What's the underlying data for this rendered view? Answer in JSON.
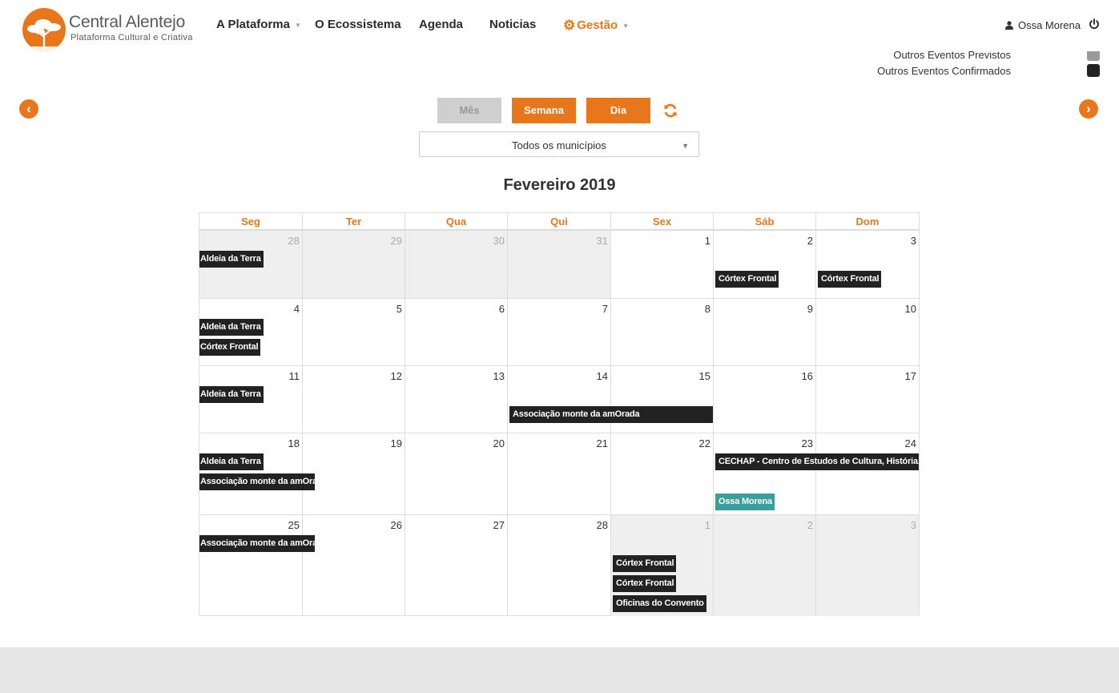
{
  "brand": {
    "title": "Central Alentejo",
    "subtitle": "Plataforma Cultural e Criativa",
    "accent": "#e8771c"
  },
  "nav": {
    "items": [
      {
        "label": "A Plataforma",
        "has_dropdown": true
      },
      {
        "label": "O Ecossistema",
        "has_dropdown": false
      },
      {
        "label": "Agenda",
        "has_dropdown": false
      },
      {
        "label": "Noticias",
        "has_dropdown": false
      },
      {
        "label": "Gestão",
        "has_dropdown": true,
        "icon": "gears-icon"
      }
    ]
  },
  "user": {
    "name": "Ossa Morena",
    "icon": "user-icon",
    "logout_icon": "power-icon"
  },
  "legend": {
    "items": [
      {
        "label": "Outros Eventos Previstos",
        "color": "#9a9a9a"
      },
      {
        "label": "Outros Eventos Confirmados",
        "color": "#222222"
      }
    ]
  },
  "toolbar": {
    "views": [
      {
        "label": "Mês",
        "active": false
      },
      {
        "label": "Semana",
        "active": true
      },
      {
        "label": "Dia",
        "active": true
      }
    ],
    "refresh_icon": "refresh-icon",
    "prev_icon": "chevron-left-icon",
    "next_icon": "chevron-right-icon",
    "municipality_select": "Todos os municípios"
  },
  "calendar": {
    "title": "Fevereiro 2019",
    "weekdays": [
      "Seg",
      "Ter",
      "Qua",
      "Qui",
      "Sex",
      "Sáb",
      "Dom"
    ],
    "weeks": [
      [
        {
          "day": "28",
          "other": true
        },
        {
          "day": "29",
          "other": true
        },
        {
          "day": "30",
          "other": true
        },
        {
          "day": "31",
          "other": true
        },
        {
          "day": "1",
          "other": false
        },
        {
          "day": "2",
          "other": false
        },
        {
          "day": "3",
          "other": false
        }
      ],
      [
        {
          "day": "4",
          "other": false
        },
        {
          "day": "5",
          "other": false
        },
        {
          "day": "6",
          "other": false
        },
        {
          "day": "7",
          "other": false
        },
        {
          "day": "8",
          "other": false
        },
        {
          "day": "9",
          "other": false
        },
        {
          "day": "10",
          "other": false
        }
      ],
      [
        {
          "day": "11",
          "other": false
        },
        {
          "day": "12",
          "other": false
        },
        {
          "day": "13",
          "other": false
        },
        {
          "day": "14",
          "other": false
        },
        {
          "day": "15",
          "other": false
        },
        {
          "day": "16",
          "other": false
        },
        {
          "day": "17",
          "other": false
        }
      ],
      [
        {
          "day": "18",
          "other": false
        },
        {
          "day": "19",
          "other": false
        },
        {
          "day": "20",
          "other": false
        },
        {
          "day": "21",
          "other": false
        },
        {
          "day": "22",
          "other": false
        },
        {
          "day": "23",
          "other": false
        },
        {
          "day": "24",
          "other": false
        }
      ],
      [
        {
          "day": "25",
          "other": false
        },
        {
          "day": "26",
          "other": false
        },
        {
          "day": "27",
          "other": false
        },
        {
          "day": "28",
          "other": false
        },
        {
          "day": "1",
          "other": true
        },
        {
          "day": "2",
          "other": true
        },
        {
          "day": "3",
          "other": true
        }
      ]
    ],
    "events": [
      {
        "title": "Aldeia da Terra",
        "week": 0,
        "col": 0,
        "slot": 0,
        "span": 1
      },
      {
        "title": "Córtex Frontal",
        "week": 0,
        "col": 5,
        "slot": 1,
        "span": 1
      },
      {
        "title": "Córtex Frontal",
        "week": 0,
        "col": 6,
        "slot": 1,
        "span": 1
      },
      {
        "title": "Aldeia da Terra",
        "week": 1,
        "col": 0,
        "slot": 0,
        "span": 1
      },
      {
        "title": "Córtex Frontal",
        "week": 1,
        "col": 0,
        "slot": 1,
        "span": 1
      },
      {
        "title": "Aldeia da Terra",
        "week": 2,
        "col": 0,
        "slot": 0,
        "span": 1
      },
      {
        "title": "Associação monte da amOrada",
        "week": 2,
        "col": 3,
        "slot": 1,
        "span": 2
      },
      {
        "title": "Aldeia da Terra",
        "week": 3,
        "col": 0,
        "slot": 0,
        "span": 1
      },
      {
        "title": "Associação monte da amOrada",
        "week": 3,
        "col": 0,
        "slot": 1,
        "span": 1
      },
      {
        "title": "CECHAP - Centro de Estudos de Cultura, História, Artes",
        "week": 3,
        "col": 5,
        "slot": 0,
        "span": 2
      },
      {
        "title": "Ossa Morena",
        "week": 3,
        "col": 5,
        "slot": 2,
        "span": 1,
        "color": "teal"
      },
      {
        "title": "Associação monte da amOrada",
        "week": 4,
        "col": 0,
        "slot": 0,
        "span": 1
      },
      {
        "title": "Córtex Frontal",
        "week": 4,
        "col": 4,
        "slot": 1,
        "span": 1
      },
      {
        "title": "Córtex Frontal",
        "week": 4,
        "col": 4,
        "slot": 2,
        "span": 1
      },
      {
        "title": "Oficinas do Convento",
        "week": 4,
        "col": 4,
        "slot": 3,
        "span": 1
      }
    ]
  }
}
